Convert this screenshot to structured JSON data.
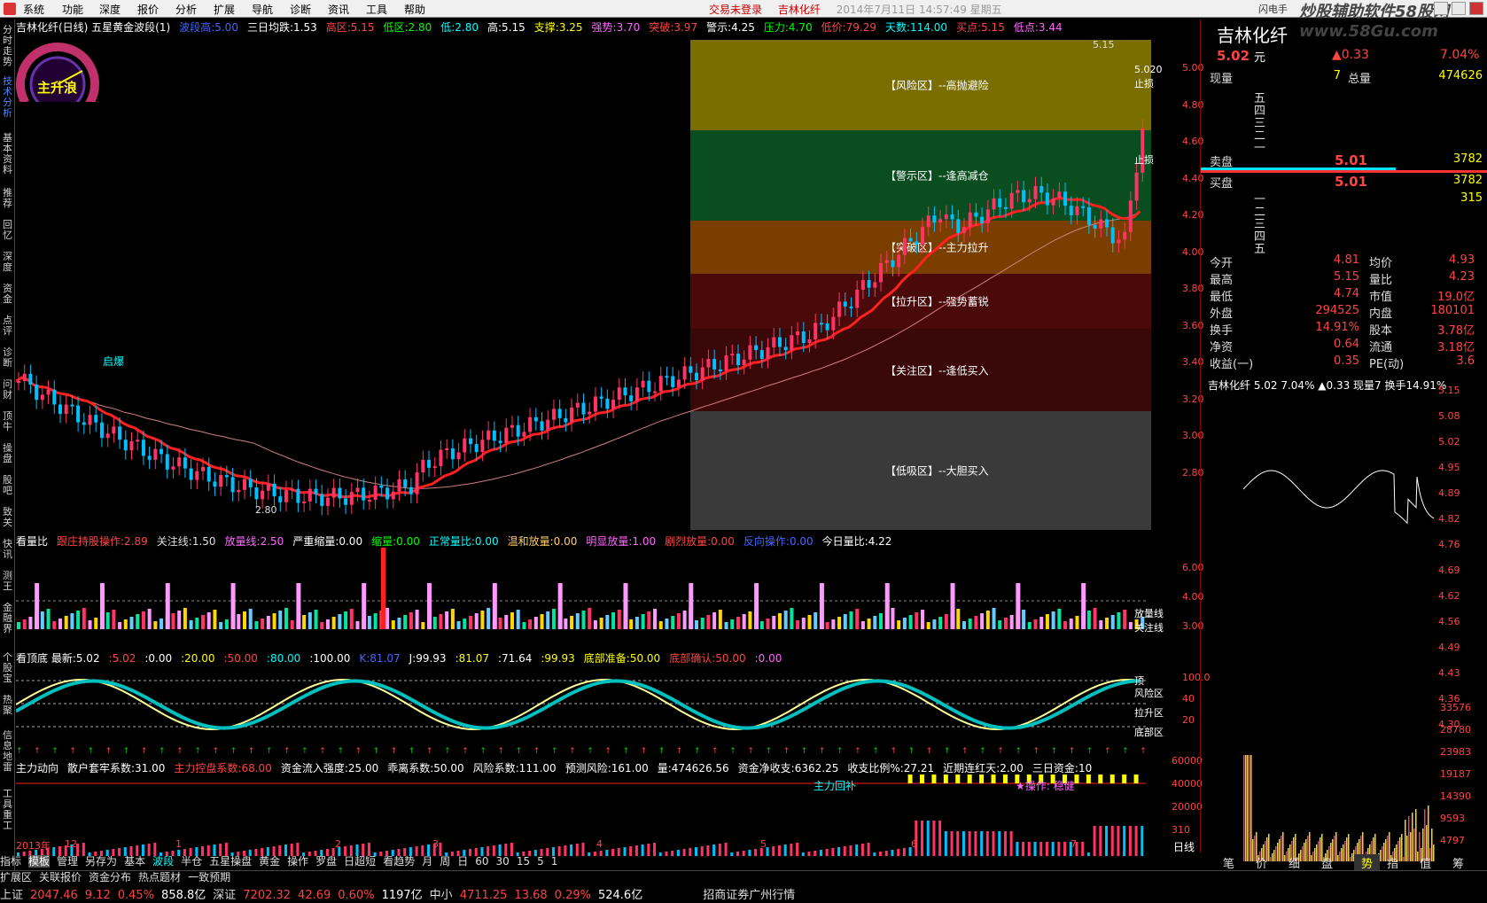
{
  "menubar": {
    "items": [
      "系统",
      "功能",
      "深度",
      "报价",
      "分析",
      "扩展",
      "导航",
      "诊断",
      "资讯",
      "工具",
      "帮助"
    ],
    "status_login": "交易未登录",
    "status_stock": "吉林化纤",
    "status_datetime": "2014年7月11日 14:57:49 星期五",
    "right_tag": "闪电手",
    "watermark": "炒股辅助软件58股网 www.58Gu.com"
  },
  "sidebar": [
    "分时走势",
    "技术分析",
    "基本资料",
    "推荐",
    "回忆",
    "深度",
    "资金",
    "点评",
    "诊断",
    "问财",
    "顶牛",
    "操盘",
    "股吧",
    "致关",
    "快讯",
    "测王",
    "金融界",
    "个股宝",
    "热聚",
    "信息地雷",
    "工具重工"
  ],
  "title_row": [
    {
      "text": "吉林化纤(日线) 五星黄金波段(1)",
      "color": "#ffffff"
    },
    {
      "text": "波段高:5.00",
      "color": "#4466ff"
    },
    {
      "text": "三日均跌:1.53",
      "color": "#ffffff"
    },
    {
      "text": "高区:5.15",
      "color": "#ff4444"
    },
    {
      "text": "低区:2.80",
      "color": "#00ff00"
    },
    {
      "text": "低:2.80",
      "color": "#00ffff"
    },
    {
      "text": "高:5.15",
      "color": "#ffffff"
    },
    {
      "text": "支撑:3.25",
      "color": "#ffff00"
    },
    {
      "text": "强势:3.70",
      "color": "#ff66ff"
    },
    {
      "text": "突破:3.97",
      "color": "#ff4444"
    },
    {
      "text": "警示:4.25",
      "color": "#ffffff"
    },
    {
      "text": "压力:4.70",
      "color": "#00ff00"
    },
    {
      "text": "低价:79.29",
      "color": "#ff4444"
    },
    {
      "text": "天数:114.00",
      "color": "#00ffff"
    },
    {
      "text": "买点:5.15",
      "color": "#ff4444"
    },
    {
      "text": "低点:3.44",
      "color": "#ff66ff"
    }
  ],
  "gauge_label": "主升浪",
  "main_chart": {
    "labels": {
      "qibao": "启爆",
      "low_mark": "2.80",
      "high_mark": "5.15",
      "stop_high": "止损",
      "last_price": "5.020",
      "stop_high2": "止损"
    },
    "zones": [
      {
        "label": "【风险区】--高抛避险",
        "color": "#7a6e00"
      },
      {
        "label": "【警示区】--逢高减仓",
        "color": "#0a4d1e"
      },
      {
        "label": "【突破区】--主力拉升",
        "color": "#7a3e00"
      },
      {
        "label": "【拉升区】--强势蓄锐",
        "color": "#4a0a0a"
      },
      {
        "label": "【关注区】--逢低买入",
        "color": "#3a0808"
      },
      {
        "label": "【低吸区】--大胆买入",
        "color": "#3a3a3a"
      }
    ]
  },
  "volume_row": [
    {
      "text": "看量比",
      "color": "#ffffff"
    },
    {
      "text": "跟庄持股操作:2.89",
      "color": "#ff4444"
    },
    {
      "text": "关注线:1.50",
      "color": "#dddddd"
    },
    {
      "text": "放量线:2.50",
      "color": "#ff66ff"
    },
    {
      "text": "严重缩量:0.00",
      "color": "#ffffff"
    },
    {
      "text": "缩量:0.00",
      "color": "#00ff00"
    },
    {
      "text": "正常量比:0.00",
      "color": "#00ffff"
    },
    {
      "text": "温和放量:0.00",
      "color": "#ffcc66"
    },
    {
      "text": "明显放量:1.00",
      "color": "#ff66ff"
    },
    {
      "text": "剧烈放量:0.00",
      "color": "#ff4444"
    },
    {
      "text": "反向操作:0.00",
      "color": "#4466ff"
    },
    {
      "text": "今日量比:4.22",
      "color": "#ffffff"
    }
  ],
  "vol_right_labels": [
    "放量线",
    "关注线"
  ],
  "ding_row": [
    {
      "text": "看顶底 最新:5.02",
      "color": "#ffffff"
    },
    {
      "text": ":5.02",
      "color": "#ff4444"
    },
    {
      "text": ":0.00",
      "color": "#ffffff"
    },
    {
      "text": ":20.00",
      "color": "#ffff00"
    },
    {
      "text": ":50.00",
      "color": "#ff4444"
    },
    {
      "text": ":80.00",
      "color": "#00ffff"
    },
    {
      "text": ":100.00",
      "color": "#ffffff"
    },
    {
      "text": "K:81.07",
      "color": "#4466ff"
    },
    {
      "text": "J:99.93",
      "color": "#ffffff"
    },
    {
      "text": ":81.07",
      "color": "#ffff00"
    },
    {
      "text": ":71.64",
      "color": "#ffffff"
    },
    {
      "text": ":99.93",
      "color": "#ffff00"
    },
    {
      "text": "底部准备:50.00",
      "color": "#ffff00"
    },
    {
      "text": "底部确认:50.00",
      "color": "#ff4444"
    },
    {
      "text": ":0.00",
      "color": "#ff66ff"
    }
  ],
  "kdj_right_labels": [
    "顶",
    "风险区",
    "拉升区",
    "底部区"
  ],
  "money_row": [
    {
      "text": "主力动向",
      "color": "#ffffff"
    },
    {
      "text": "散户套牢系数:31.00",
      "color": "#ffffff"
    },
    {
      "text": "主力控盘系数:68.00",
      "color": "#ff4444"
    },
    {
      "text": "资金流入强度:25.00",
      "color": "#ffffff"
    },
    {
      "text": "乖离系数:50.00",
      "color": "#ffffff"
    },
    {
      "text": "风险系数:111.00",
      "color": "#ffffff"
    },
    {
      "text": "预测风险:161.00",
      "color": "#ffffff"
    },
    {
      "text": "量:474626.56",
      "color": "#ffffff"
    },
    {
      "text": "资金净收支:6362.25",
      "color": "#ffffff"
    },
    {
      "text": "收支比例%:27.21",
      "color": "#ffffff"
    },
    {
      "text": "近期连红天:2.00",
      "color": "#ffffff"
    },
    {
      "text": "三日资金:10",
      "color": "#ffffff"
    }
  ],
  "money_labels": {
    "zl": "主力回补",
    "op": "★操作: 稳健"
  },
  "time_axis": [
    "2013年",
    "12",
    "1",
    "2",
    "3",
    "4",
    "5",
    "6",
    "7"
  ],
  "chart_tabs": [
    "指标",
    "模板",
    "管理",
    "另存为",
    "基本",
    "波段",
    "半仓",
    "五星操盘",
    "黄金",
    "操作",
    "罗盘",
    "日超短",
    "看趋势",
    "月",
    "周",
    "日",
    "60",
    "30",
    "15",
    "5",
    "1"
  ],
  "bottom_tabs": [
    "扩展区",
    "关联报价",
    "资金分布",
    "热点题材",
    "一致预期"
  ],
  "statusline": [
    {
      "label": "上证",
      "val": "2047.46",
      "chg": "9.12",
      "pct": "0.45%",
      "amt": "858.8亿"
    },
    {
      "label": "深证",
      "val": "7202.32",
      "chg": "42.69",
      "pct": "0.60%",
      "amt": "1197亿"
    },
    {
      "label": "中小",
      "val": "4711.25",
      "chg": "13.68",
      "pct": "0.29%",
      "amt": "524.6亿"
    }
  ],
  "broker": "招商证券广州行情",
  "quote": {
    "name": "吉林化纤",
    "price": "5.02",
    "unit": "元",
    "change": "▲0.33",
    "pct": "7.04%",
    "xianliang_label": "现量",
    "xianliang": "7",
    "zongliang_label": "总量",
    "zongliang": "474626",
    "sell_labels": [
      "五",
      "四",
      "三",
      "二",
      "一"
    ],
    "buy_labels": [
      "一",
      "二",
      "三",
      "四",
      "五"
    ],
    "sell_pan": "卖盘",
    "sell_price": "5.01",
    "sell_vol": "3782",
    "buy_pan": "买盘",
    "buy_price": "5.01",
    "buy_vol": "3782",
    "buy2_vol": "315",
    "stats": [
      [
        "今开",
        "4.81",
        "均价",
        "4.93"
      ],
      [
        "最高",
        "5.15",
        "量比",
        "4.23"
      ],
      [
        "最低",
        "4.74",
        "市值",
        "19.0亿"
      ],
      [
        "外盘",
        "294525",
        "内盘",
        "180101"
      ],
      [
        "换手",
        "14.91%",
        "股本",
        "3.78亿"
      ],
      [
        "净资",
        "0.64",
        "流通",
        "3.18亿"
      ],
      [
        "收益(一)",
        "0.35",
        "PE(动)",
        "3.6"
      ]
    ],
    "mini_title": "吉林化纤 5.02 7.04% ▲0.33 现量7 换手14.91%",
    "right_axis": [
      "5.15",
      "5.08",
      "5.02",
      "4.95",
      "4.89",
      "4.82",
      "4.76",
      "4.69",
      "4.62",
      "4.56",
      "4.49",
      "4.43",
      "4.36",
      "4.30"
    ],
    "left_axis": [
      "5.00",
      "4.80",
      "4.60",
      "4.40",
      "4.20",
      "4.00",
      "3.80",
      "3.60",
      "3.40",
      "3.20",
      "3.00",
      "2.80"
    ],
    "vol_axis": [
      "33576",
      "28780",
      "23983",
      "19187",
      "14390",
      "9593",
      "4797"
    ],
    "sub_axis": [
      "6.00",
      "4.00",
      "3.00"
    ],
    "kdj_axis": [
      "100.0",
      "40",
      "20"
    ],
    "money_axis": [
      "60000",
      "40000",
      "20000",
      "310"
    ],
    "period": "日线",
    "bottom_tabs": [
      "笔",
      "价",
      "细",
      "盘",
      "势",
      "指",
      "值",
      "筹"
    ]
  }
}
